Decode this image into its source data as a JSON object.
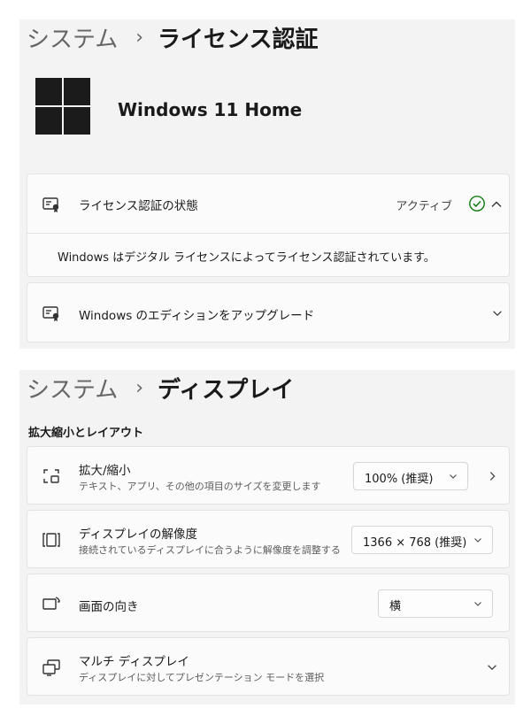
{
  "license_panel": {
    "breadcrumb": {
      "parent": "システム",
      "separator": "›",
      "current": "ライセンス認証"
    },
    "product_name": "Windows 11 Home",
    "activation_state": {
      "title": "ライセンス認証の状態",
      "status": "アクティブ",
      "status_color": "#107c10",
      "expanded": true,
      "detail": "Windows はデジタル ライセンスによってライセンス認証されています。"
    },
    "upgrade": {
      "title": "Windows のエディションをアップグレード"
    }
  },
  "display_panel": {
    "breadcrumb": {
      "parent": "システム",
      "separator": "›",
      "current": "ディスプレイ"
    },
    "section_title": "拡大縮小とレイアウト",
    "scale": {
      "title": "拡大/縮小",
      "subtitle": "テキスト、アプリ、その他の項目のサイズを変更します",
      "value": "100% (推奨)"
    },
    "resolution": {
      "title": "ディスプレイの解像度",
      "subtitle": "接続されているディスプレイに合うように解像度を調整する",
      "value": "1366 × 768 (推奨)"
    },
    "orientation": {
      "title": "画面の向き",
      "value": "横"
    },
    "multi_display": {
      "title": "マルチ ディスプレイ",
      "subtitle": "ディスプレイに対してプレゼンテーション モードを選択"
    }
  }
}
